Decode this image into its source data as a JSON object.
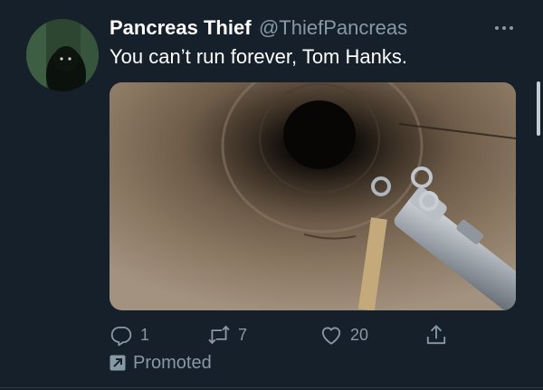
{
  "tweet": {
    "display_name": "Pancreas Thief",
    "handle": "@ThiefPancreas",
    "text": "You can’t run forever, Tom Hanks.",
    "media": {
      "description_icon": "photo-tunnel-rifle"
    },
    "actions": {
      "reply_count": "1",
      "retweet_count": "7",
      "like_count": "20"
    },
    "promoted_label": "Promoted"
  },
  "icons": {
    "more": "more-horizontal-icon",
    "reply": "reply-icon",
    "retweet": "retweet-icon",
    "like": "heart-icon",
    "share": "share-icon",
    "promoted": "promoted-arrow-icon"
  },
  "colors": {
    "background": "#15202b",
    "primary_text": "#ffffff",
    "secondary_text": "#8899a6",
    "divider": "#2a3946"
  }
}
